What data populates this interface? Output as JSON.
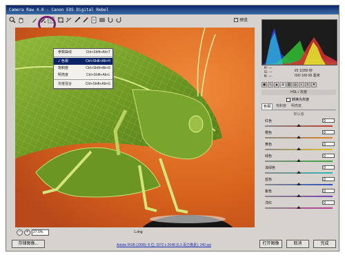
{
  "window": {
    "title": "Camera Raw 4.0 - Canon EOS Digital Rebel"
  },
  "toolbar": {
    "tools": [
      "zoom-icon",
      "hand-icon",
      "white-balance-icon",
      "color-sampler-icon",
      "target-adjust-icon",
      "crop-icon",
      "straighten-icon",
      "spot-removal-icon",
      "red-eye-icon",
      "preferences-icon",
      "rotate-left-icon",
      "rotate-right-icon"
    ],
    "preview_label": "预览",
    "preview_checked": true
  },
  "dropdown": {
    "items": [
      {
        "label": "参数曲线",
        "shortcut": "Ctrl+Shift+Alt+T",
        "checked": false,
        "active": false
      },
      {
        "label": "色相",
        "shortcut": "Ctrl+Shift+Alt+H",
        "checked": true,
        "active": true
      },
      {
        "label": "饱和度",
        "shortcut": "Ctrl+Shift+Alt+S",
        "checked": false,
        "active": false
      },
      {
        "label": "明亮度",
        "shortcut": "Ctrl+Shift+Alt+L",
        "checked": false,
        "active": false
      },
      {
        "label": "灰度混合",
        "shortcut": "Ctrl+Shift+Alt+G",
        "checked": false,
        "active": false
      }
    ]
  },
  "status": {
    "zoom": "27.5%",
    "filename": "1.dng"
  },
  "readout": {
    "rgb_labels": [
      "R: ---",
      "G: ---",
      "B: ---"
    ],
    "line1": "f/2  1/250 秒",
    "line2": "ISO 100  65 毫米"
  },
  "panel": {
    "section_title": "HSL / 灰度",
    "grayscale_label": "转换为灰度",
    "subtabs": [
      "色相",
      "饱和度",
      "明亮度"
    ],
    "defaults_label": "默认值",
    "sliders": [
      {
        "label": "红色",
        "value": "0",
        "color": "#c0392b",
        "level": 0.5
      },
      {
        "label": "橙色",
        "value": "0",
        "color": "#e67e22",
        "level": 0.5
      },
      {
        "label": "黄色",
        "value": "0",
        "color": "#e0c020",
        "level": 0.5
      },
      {
        "label": "绿色",
        "value": "0",
        "color": "#3aa53a",
        "level": 0.5
      },
      {
        "label": "浅绿色",
        "value": "0",
        "color": "#2fb5b5",
        "level": 0.5
      },
      {
        "label": "蓝色",
        "value": "0",
        "color": "#2a4fc0",
        "level": 0.5
      },
      {
        "label": "紫色",
        "value": "0",
        "color": "#7a3ab5",
        "level": 0.5
      },
      {
        "label": "洋红",
        "value": "0",
        "color": "#c0349a",
        "level": 0.5
      }
    ]
  },
  "bottom": {
    "save_label": "存储图像...",
    "workflow_link": "Adobe RGB (1998); 8 位; 3072 x 2048 (6.3 百万像素); 240 ppi",
    "open_label": "打开图像",
    "cancel_label": "取消",
    "done_label": "完成"
  }
}
